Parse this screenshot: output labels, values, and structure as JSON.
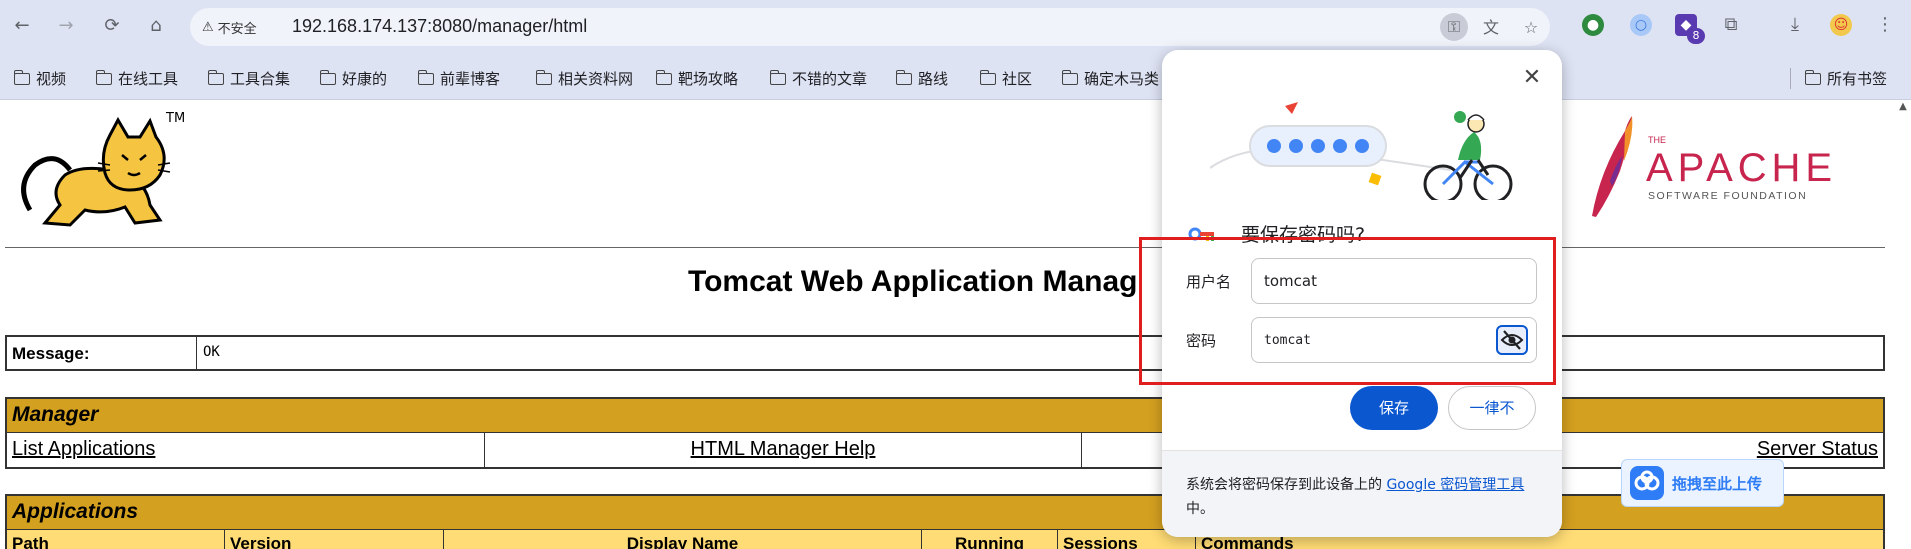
{
  "browser": {
    "security_label": "不安全",
    "url": "192.168.174.137:8080/manager/html",
    "extension_badge": "8",
    "bookmarks": [
      "视频",
      "在线工具",
      "工具合集",
      "好康的",
      "前辈博客",
      "相关资料网",
      "靶场攻略",
      "不错的文章",
      "路线",
      "社区",
      "确定木马类"
    ],
    "all_bookmarks_label": "所有书签"
  },
  "page": {
    "tm_mark": "TM",
    "title": "Tomcat Web Application Manag",
    "message_label": "Message:",
    "message_value": "OK",
    "manager_heading": "Manager",
    "manager_links": [
      "List Applications",
      "HTML Manager Help",
      "Server Status"
    ],
    "applications_heading": "Applications",
    "app_columns": [
      "Path",
      "Version",
      "Display Name",
      "Running",
      "Sessions",
      "Commands"
    ]
  },
  "apache_logo": {
    "the": "THE",
    "name": "APACHE",
    "subtitle": "SOFTWARE FOUNDATION"
  },
  "password_popup": {
    "title": "要保存密码吗?",
    "username_label": "用户名",
    "username_value": "tomcat",
    "password_label": "密码",
    "password_value": "tomcat",
    "save_label": "保存",
    "never_label": "一律不",
    "footer_text": "系统会将密码保存到此设备上的 ",
    "footer_link": "Google 密码管理工具",
    "footer_suffix": "中。"
  },
  "baidu_badge": {
    "label": "拖拽至此上传"
  },
  "colors": {
    "browser_bg": "#dee3f4",
    "manager_header": "#d4a020",
    "table_header": "#ffdc75",
    "primary_blue": "#0b57d0",
    "highlight_red": "#e01e1e"
  }
}
